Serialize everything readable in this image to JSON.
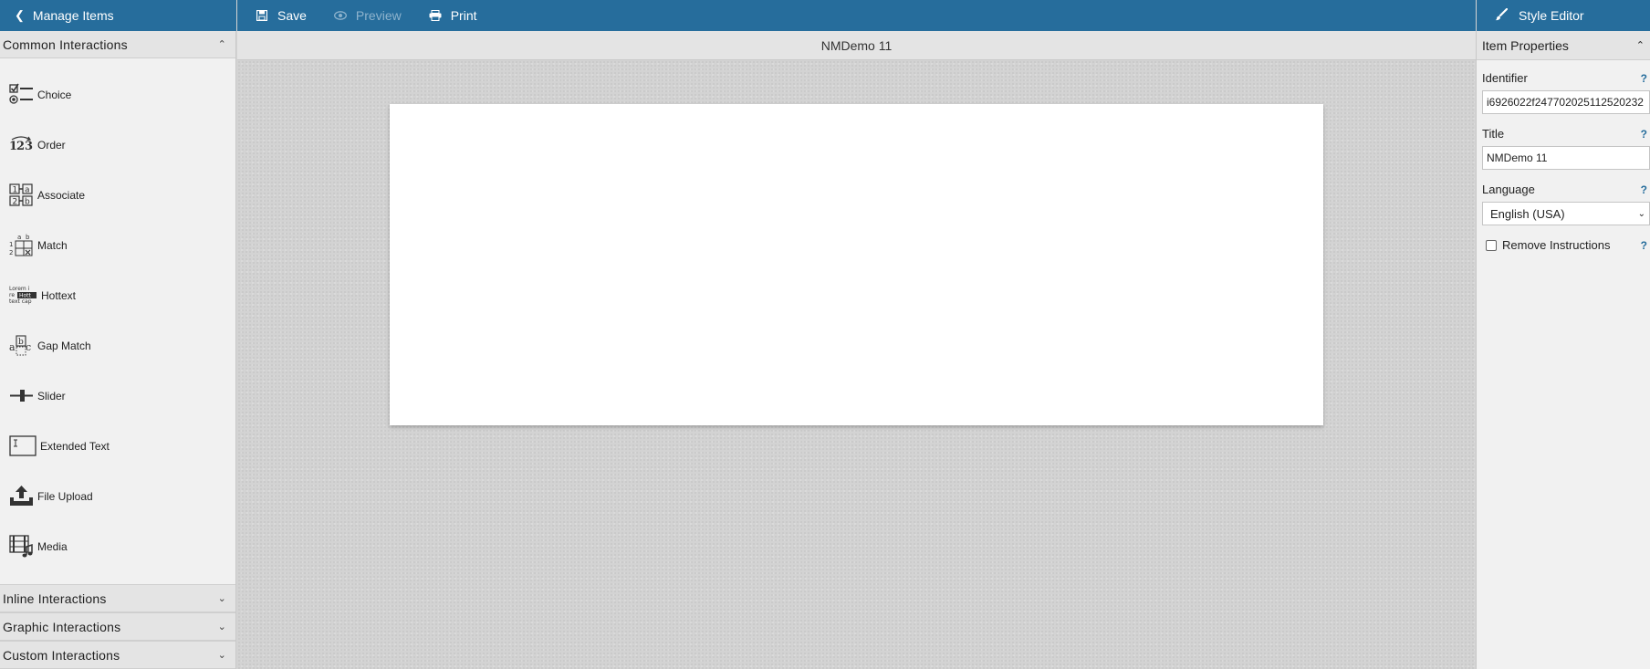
{
  "toolbar": {
    "manage_items": "Manage Items",
    "save": "Save",
    "preview": "Preview",
    "print": "Print",
    "style_editor": "Style Editor"
  },
  "left_panel": {
    "common_title": "Common Interactions",
    "items": [
      {
        "label": "Choice",
        "icon": "choice-icon"
      },
      {
        "label": "Order",
        "icon": "order-icon"
      },
      {
        "label": "Associate",
        "icon": "associate-icon"
      },
      {
        "label": "Match",
        "icon": "match-icon"
      },
      {
        "label": "Hottext",
        "icon": "hottext-icon"
      },
      {
        "label": "Gap Match",
        "icon": "gap-match-icon"
      },
      {
        "label": "Slider",
        "icon": "slider-icon"
      },
      {
        "label": "Extended Text",
        "icon": "extended-text-icon"
      },
      {
        "label": "File Upload",
        "icon": "file-upload-icon"
      },
      {
        "label": "Media",
        "icon": "media-icon"
      }
    ],
    "inline_title": "Inline Interactions",
    "graphic_title": "Graphic Interactions",
    "custom_title": "Custom Interactions"
  },
  "center": {
    "title": "NMDemo 11"
  },
  "right_panel": {
    "title": "Item Properties",
    "identifier_label": "Identifier",
    "identifier_value": "i6926022f247702025112520232",
    "title_label": "Title",
    "title_value": "NMDemo 11",
    "language_label": "Language",
    "language_value": "English (USA)",
    "remove_instructions": "Remove Instructions",
    "help": "?"
  },
  "colors": {
    "topbar": "#266d9c",
    "panel": "#f1f1f1",
    "canvas_bg": "#d3d3d3"
  }
}
